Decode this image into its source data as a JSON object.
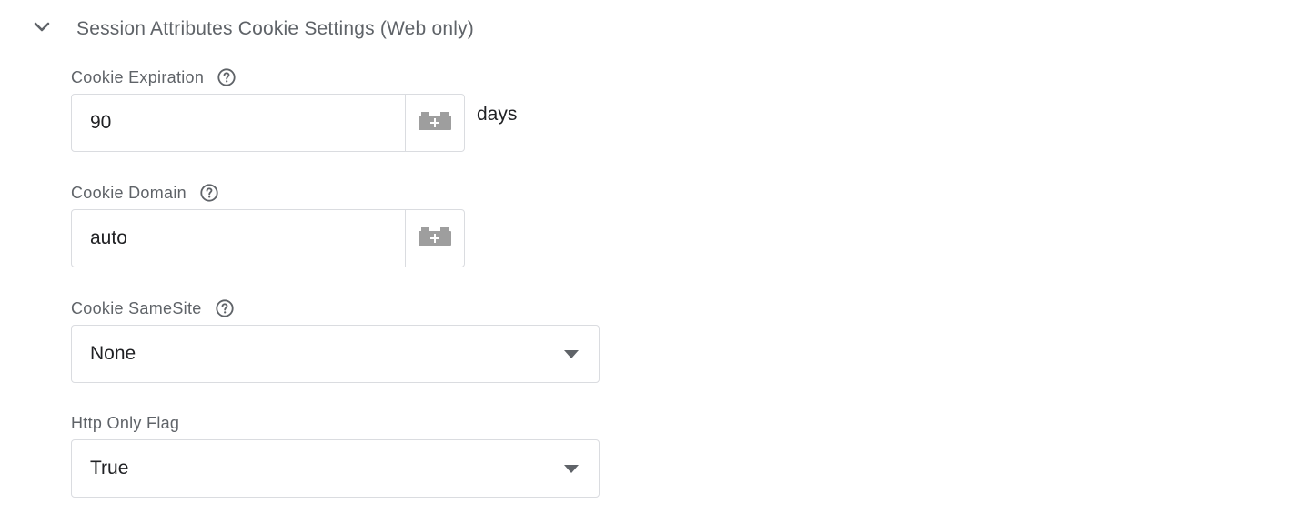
{
  "section": {
    "title": "Session Attributes Cookie Settings (Web only)",
    "expanded": true,
    "chevron_icon": "chevron-down-icon"
  },
  "fields": {
    "cookie_expiration": {
      "label": "Cookie Expiration",
      "value": "90",
      "unit": "days",
      "help_icon": "help-circle-icon",
      "variable_icon": "variable-picker-icon"
    },
    "cookie_domain": {
      "label": "Cookie Domain",
      "value": "auto",
      "help_icon": "help-circle-icon",
      "variable_icon": "variable-picker-icon"
    },
    "cookie_samesite": {
      "label": "Cookie SameSite",
      "selected": "None",
      "help_icon": "help-circle-icon"
    },
    "http_only_flag": {
      "label": "Http Only Flag",
      "selected": "True"
    }
  },
  "colors": {
    "label_text": "#5f6368",
    "value_text": "#202124",
    "border": "#dadce0",
    "icon_gray": "#9e9e9e"
  }
}
